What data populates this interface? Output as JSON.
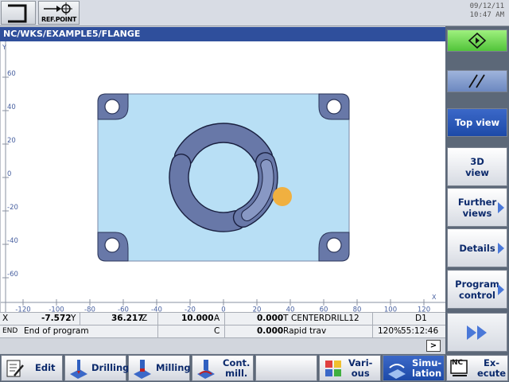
{
  "topbar": {
    "ref_point_label": "REF.POINT",
    "date": "09/12/11",
    "time": "10:47 AM"
  },
  "path": "NC/WKS/EXAMPLE5/FLANGE",
  "plot": {
    "x_ticks": [
      "-120",
      "-100",
      "-80",
      "-60",
      "-40",
      "-20",
      "0",
      "20",
      "40",
      "60",
      "80",
      "100",
      "120"
    ],
    "y_ticks": [
      "60",
      "40",
      "20",
      "0",
      "-20",
      "-40",
      "-60"
    ],
    "x_axis_label": "X",
    "y_axis_label": "Y",
    "colors": {
      "stock": "#b8dff5",
      "part": "#6878a8",
      "tool": "#f0b040"
    }
  },
  "status": {
    "row1": {
      "x_label": "X",
      "x_value": "-7.572",
      "y_label": "Y",
      "y_value": "36.217",
      "z_label": "Z",
      "z_value": "10.000",
      "a_label": "A",
      "a_value": "0.000",
      "tool_label": "T",
      "tool_name": "CENTERDRILL12",
      "d_label": "D1"
    },
    "row2": {
      "block": "END",
      "message": "End of program",
      "c_label": "C",
      "c_value": "0.000",
      "feed": "Rapid trav",
      "override": "120%",
      "elapsed": "55:12:46"
    },
    "row3": {
      "next_label": ">"
    }
  },
  "vertical_softkeys": {
    "start_icon": "diamond-start-icon",
    "parallel_icon": "double-slash-icon",
    "top_view": "Top view",
    "view_3d_line1": "3D",
    "view_3d_line2": "view",
    "further_views_line1": "Further",
    "further_views_line2": "views",
    "details": "Details",
    "program_control_line1": "Program",
    "program_control_line2": "control",
    "fast_forward_icon": "fast-forward-icon"
  },
  "horizontal_softkeys": {
    "edit": "Edit",
    "drilling": "Drilling",
    "milling": "Milling",
    "cont_mill_line1": "Cont.",
    "cont_mill_line2": "mill.",
    "various_line1": "Vari-",
    "various_line2": "ous",
    "simulation_line1": "Simu-",
    "simulation_line2": "lation",
    "nc_badge": "NC",
    "execute_line1": "Ex-",
    "execute_line2": "ecute"
  }
}
